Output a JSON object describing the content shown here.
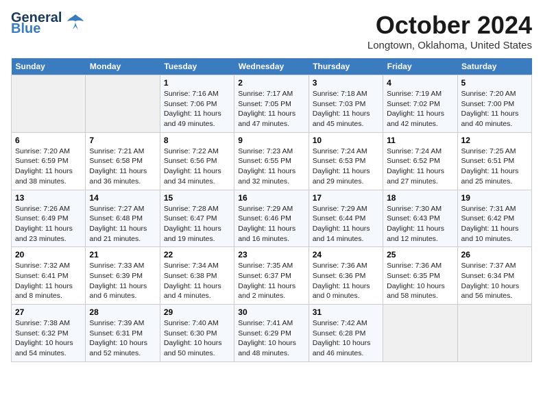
{
  "logo": {
    "line1": "General",
    "line2": "Blue"
  },
  "title": "October 2024",
  "location": "Longtown, Oklahoma, United States",
  "weekdays": [
    "Sunday",
    "Monday",
    "Tuesday",
    "Wednesday",
    "Thursday",
    "Friday",
    "Saturday"
  ],
  "weeks": [
    [
      {
        "day": "",
        "content": ""
      },
      {
        "day": "",
        "content": ""
      },
      {
        "day": "1",
        "content": "Sunrise: 7:16 AM\nSunset: 7:06 PM\nDaylight: 11 hours and 49 minutes."
      },
      {
        "day": "2",
        "content": "Sunrise: 7:17 AM\nSunset: 7:05 PM\nDaylight: 11 hours and 47 minutes."
      },
      {
        "day": "3",
        "content": "Sunrise: 7:18 AM\nSunset: 7:03 PM\nDaylight: 11 hours and 45 minutes."
      },
      {
        "day": "4",
        "content": "Sunrise: 7:19 AM\nSunset: 7:02 PM\nDaylight: 11 hours and 42 minutes."
      },
      {
        "day": "5",
        "content": "Sunrise: 7:20 AM\nSunset: 7:00 PM\nDaylight: 11 hours and 40 minutes."
      }
    ],
    [
      {
        "day": "6",
        "content": "Sunrise: 7:20 AM\nSunset: 6:59 PM\nDaylight: 11 hours and 38 minutes."
      },
      {
        "day": "7",
        "content": "Sunrise: 7:21 AM\nSunset: 6:58 PM\nDaylight: 11 hours and 36 minutes."
      },
      {
        "day": "8",
        "content": "Sunrise: 7:22 AM\nSunset: 6:56 PM\nDaylight: 11 hours and 34 minutes."
      },
      {
        "day": "9",
        "content": "Sunrise: 7:23 AM\nSunset: 6:55 PM\nDaylight: 11 hours and 32 minutes."
      },
      {
        "day": "10",
        "content": "Sunrise: 7:24 AM\nSunset: 6:53 PM\nDaylight: 11 hours and 29 minutes."
      },
      {
        "day": "11",
        "content": "Sunrise: 7:24 AM\nSunset: 6:52 PM\nDaylight: 11 hours and 27 minutes."
      },
      {
        "day": "12",
        "content": "Sunrise: 7:25 AM\nSunset: 6:51 PM\nDaylight: 11 hours and 25 minutes."
      }
    ],
    [
      {
        "day": "13",
        "content": "Sunrise: 7:26 AM\nSunset: 6:49 PM\nDaylight: 11 hours and 23 minutes."
      },
      {
        "day": "14",
        "content": "Sunrise: 7:27 AM\nSunset: 6:48 PM\nDaylight: 11 hours and 21 minutes."
      },
      {
        "day": "15",
        "content": "Sunrise: 7:28 AM\nSunset: 6:47 PM\nDaylight: 11 hours and 19 minutes."
      },
      {
        "day": "16",
        "content": "Sunrise: 7:29 AM\nSunset: 6:46 PM\nDaylight: 11 hours and 16 minutes."
      },
      {
        "day": "17",
        "content": "Sunrise: 7:29 AM\nSunset: 6:44 PM\nDaylight: 11 hours and 14 minutes."
      },
      {
        "day": "18",
        "content": "Sunrise: 7:30 AM\nSunset: 6:43 PM\nDaylight: 11 hours and 12 minutes."
      },
      {
        "day": "19",
        "content": "Sunrise: 7:31 AM\nSunset: 6:42 PM\nDaylight: 11 hours and 10 minutes."
      }
    ],
    [
      {
        "day": "20",
        "content": "Sunrise: 7:32 AM\nSunset: 6:41 PM\nDaylight: 11 hours and 8 minutes."
      },
      {
        "day": "21",
        "content": "Sunrise: 7:33 AM\nSunset: 6:39 PM\nDaylight: 11 hours and 6 minutes."
      },
      {
        "day": "22",
        "content": "Sunrise: 7:34 AM\nSunset: 6:38 PM\nDaylight: 11 hours and 4 minutes."
      },
      {
        "day": "23",
        "content": "Sunrise: 7:35 AM\nSunset: 6:37 PM\nDaylight: 11 hours and 2 minutes."
      },
      {
        "day": "24",
        "content": "Sunrise: 7:36 AM\nSunset: 6:36 PM\nDaylight: 11 hours and 0 minutes."
      },
      {
        "day": "25",
        "content": "Sunrise: 7:36 AM\nSunset: 6:35 PM\nDaylight: 10 hours and 58 minutes."
      },
      {
        "day": "26",
        "content": "Sunrise: 7:37 AM\nSunset: 6:34 PM\nDaylight: 10 hours and 56 minutes."
      }
    ],
    [
      {
        "day": "27",
        "content": "Sunrise: 7:38 AM\nSunset: 6:32 PM\nDaylight: 10 hours and 54 minutes."
      },
      {
        "day": "28",
        "content": "Sunrise: 7:39 AM\nSunset: 6:31 PM\nDaylight: 10 hours and 52 minutes."
      },
      {
        "day": "29",
        "content": "Sunrise: 7:40 AM\nSunset: 6:30 PM\nDaylight: 10 hours and 50 minutes."
      },
      {
        "day": "30",
        "content": "Sunrise: 7:41 AM\nSunset: 6:29 PM\nDaylight: 10 hours and 48 minutes."
      },
      {
        "day": "31",
        "content": "Sunrise: 7:42 AM\nSunset: 6:28 PM\nDaylight: 10 hours and 46 minutes."
      },
      {
        "day": "",
        "content": ""
      },
      {
        "day": "",
        "content": ""
      }
    ]
  ]
}
